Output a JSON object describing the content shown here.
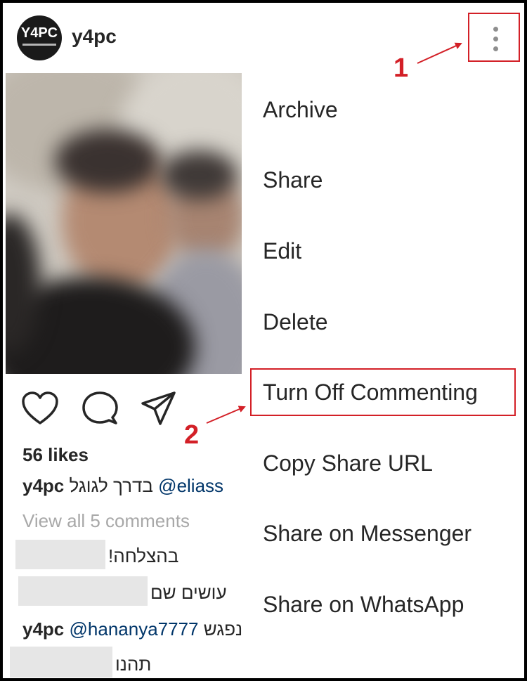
{
  "post": {
    "username": "y4pc",
    "avatar_logo": "Y4PC",
    "more_icon": "more-vertical-icon",
    "likes": "56 likes",
    "caption_owner": "y4pc",
    "caption_text": "בדרך לגוגל",
    "caption_mention": "@eliass",
    "view_comments": "View all 5 comments",
    "comments": [
      {
        "text": "בהצלחה!"
      },
      {
        "text": "עושים שם"
      },
      {
        "owner": "y4pc",
        "mention": "@hananya7777",
        "text": "נפגש"
      },
      {
        "text": "תהנו"
      }
    ]
  },
  "action_icons": [
    "heart-icon",
    "comment-icon",
    "share-icon"
  ],
  "menu": {
    "items": [
      {
        "label": "Archive"
      },
      {
        "label": "Share"
      },
      {
        "label": "Edit"
      },
      {
        "label": "Delete"
      },
      {
        "label": "Turn Off Commenting"
      },
      {
        "label": "Copy Share URL"
      },
      {
        "label": "Share on Messenger"
      },
      {
        "label": "Share on WhatsApp"
      }
    ]
  },
  "annotations": {
    "step1": "1",
    "step2": "2",
    "color": "#d32027"
  }
}
